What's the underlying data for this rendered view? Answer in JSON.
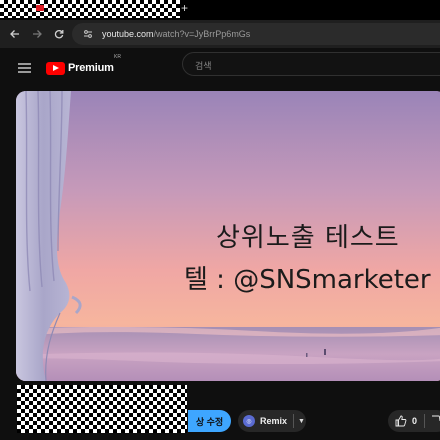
{
  "browser": {
    "new_tab_glyph": "+",
    "url_host": "youtube.com",
    "url_path": "/watch?v=JyBrrPp6mGs"
  },
  "masthead": {
    "logo_text": "Premium",
    "country_code": "KR",
    "search_placeholder": "검색"
  },
  "video": {
    "overlay_line1": "상위노출 테스트",
    "overlay_line2": "텔 : @SNSmarketer"
  },
  "actions": {
    "edit_label": "상 수정",
    "remix_label": "Remix",
    "like_count": "0"
  },
  "colors": {
    "page_background": "#0f0f0f",
    "youtube_red": "#ff0000",
    "edit_button_blue": "#3ea6ff",
    "chip_background": "#272727"
  }
}
